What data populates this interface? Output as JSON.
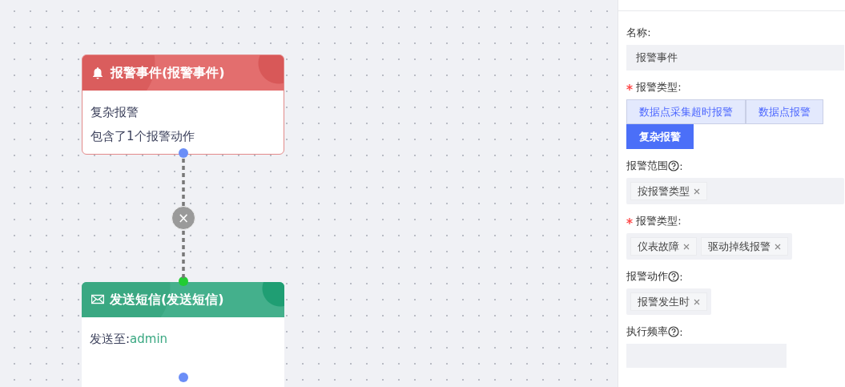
{
  "canvas": {
    "nodes": [
      {
        "kind": "alarm",
        "title": "报警事件(报警事件)",
        "lines": [
          "复杂报警",
          "包含了1个报警动作"
        ]
      },
      {
        "kind": "sms",
        "title": "发送短信(发送短信)",
        "label": "发送至:",
        "value": "admin"
      }
    ],
    "edge_delete": "×"
  },
  "panel": {
    "fields": [
      {
        "kind": "text",
        "label": "名称:",
        "required": false,
        "help": false,
        "value": "报警事件"
      },
      {
        "kind": "segmented",
        "label": "报警类型:",
        "required": true,
        "help": false,
        "options": [
          {
            "label": "数据点采集超时报警",
            "selected": false
          },
          {
            "label": "数据点报警",
            "selected": false
          },
          {
            "label": "复杂报警",
            "selected": true
          }
        ]
      },
      {
        "kind": "tags",
        "label": "报警范围",
        "suffix": ":",
        "required": false,
        "help": true,
        "wide": true,
        "tags": [
          "按报警类型"
        ]
      },
      {
        "kind": "tags",
        "label": "报警类型:",
        "required": true,
        "help": false,
        "wide": false,
        "tags": [
          "仪表故障",
          "驱动掉线报警"
        ]
      },
      {
        "kind": "tags",
        "label": "报警动作",
        "suffix": ":",
        "required": false,
        "help": true,
        "wide": false,
        "tags": [
          "报警发生时"
        ]
      },
      {
        "kind": "empty",
        "label": "执行频率",
        "suffix": ":",
        "required": false,
        "help": true
      }
    ]
  }
}
